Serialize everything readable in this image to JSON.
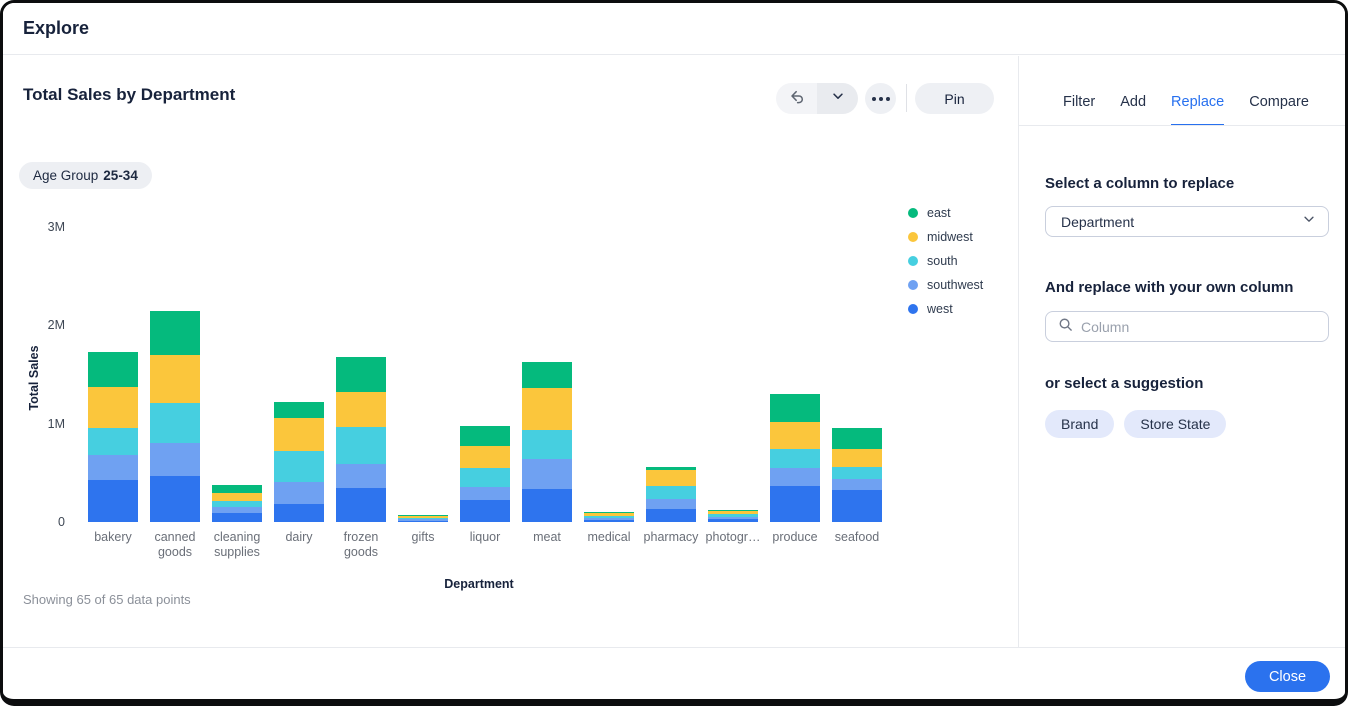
{
  "window": {
    "title": "Explore"
  },
  "chart_header": {
    "title": "Total Sales by Department",
    "toolbar": {
      "pin_label": "Pin"
    }
  },
  "filter_chip": {
    "label": "Age Group",
    "value": "25-34"
  },
  "chart_data": {
    "type": "bar",
    "stacked": true,
    "title": "Total Sales by Department",
    "xlabel": "Department",
    "ylabel": "Total Sales",
    "ylim": [
      0,
      3000000
    ],
    "grid": false,
    "legend_position": "right",
    "yticks": [
      {
        "label": "0",
        "value": 0
      },
      {
        "label": "1M",
        "value": 1000000
      },
      {
        "label": "2M",
        "value": 2000000
      },
      {
        "label": "3M",
        "value": 3000000
      }
    ],
    "categories": [
      "bakery",
      "canned goods",
      "cleaning supplies",
      "dairy",
      "frozen goods",
      "gifts",
      "liquor",
      "meat",
      "medical",
      "pharmacy",
      "photogr…",
      "produce",
      "seafood"
    ],
    "category_labels_display": [
      [
        "bakery"
      ],
      [
        "canned",
        "goods"
      ],
      [
        "cleaning",
        "supplies"
      ],
      [
        "dairy"
      ],
      [
        "frozen",
        "goods"
      ],
      [
        "gifts"
      ],
      [
        "liquor"
      ],
      [
        "meat"
      ],
      [
        "medical"
      ],
      [
        "pharmacy"
      ],
      [
        "photogr…"
      ],
      [
        "produce"
      ],
      [
        "seafood"
      ]
    ],
    "series": [
      {
        "name": "east",
        "color": "#05ba7d",
        "values": [
          360000,
          440000,
          90000,
          160000,
          360000,
          12000,
          200000,
          260000,
          5000,
          30000,
          15000,
          280000,
          210000
        ]
      },
      {
        "name": "midwest",
        "color": "#fbc63c",
        "values": [
          420000,
          490000,
          80000,
          340000,
          360000,
          15000,
          220000,
          430000,
          40000,
          160000,
          30000,
          280000,
          180000
        ]
      },
      {
        "name": "south",
        "color": "#46cfe0",
        "values": [
          270000,
          410000,
          60000,
          310000,
          370000,
          15000,
          190000,
          290000,
          20000,
          140000,
          25000,
          190000,
          120000
        ]
      },
      {
        "name": "southwest",
        "color": "#6fa1f2",
        "values": [
          250000,
          330000,
          60000,
          230000,
          240000,
          13000,
          140000,
          300000,
          20000,
          100000,
          25000,
          180000,
          120000
        ]
      },
      {
        "name": "west",
        "color": "#2e74ee",
        "values": [
          430000,
          470000,
          90000,
          180000,
          350000,
          15000,
          220000,
          340000,
          20000,
          130000,
          30000,
          370000,
          320000
        ]
      }
    ],
    "stack_order_bottom_to_top": [
      "west",
      "southwest",
      "south",
      "midwest",
      "east"
    ],
    "footnote": "Showing 65 of 65 data points"
  },
  "panel": {
    "tabs": [
      {
        "label": "Filter",
        "active": false
      },
      {
        "label": "Add",
        "active": false
      },
      {
        "label": "Replace",
        "active": true
      },
      {
        "label": "Compare",
        "active": false
      }
    ],
    "replace": {
      "select_label": "Select a column to replace",
      "selected_column": "Department",
      "replace_with_label": "And replace with your own column",
      "search_placeholder": "Column",
      "suggestion_label": "or select a suggestion",
      "suggestions": [
        "Brand",
        "Store State"
      ]
    }
  },
  "footer": {
    "close_label": "Close"
  },
  "colors": {
    "accent_blue": "#2770ef",
    "chip_bg": "#e3e9fb",
    "button_bg": "#eef0f4"
  }
}
